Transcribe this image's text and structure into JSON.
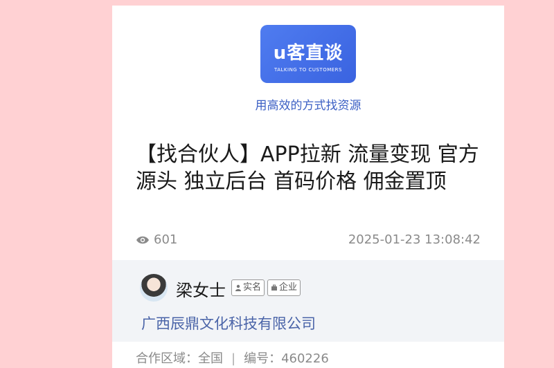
{
  "logo": {
    "text": "u客直谈",
    "subtitle": "TALKING TO CUSTOMERS",
    "color": "#4a74ee"
  },
  "tagline": "用高效的方式找资源",
  "post": {
    "title": "【找合伙人】APP拉新 流量变现 官方源头 独立后台 首码价格 佣金置顶",
    "views": "601",
    "date": "2025-01-23 13:08:42"
  },
  "author": {
    "name": "梁女士",
    "badges": [
      "实名",
      "企业"
    ],
    "company": "广西辰鼎文化科技有限公司"
  },
  "details": {
    "region_label": "合作区域：",
    "region_value": "全国",
    "separator": "|",
    "id_label": "编号：",
    "id_value": "460226"
  },
  "icons": {
    "views": "eye-icon",
    "badge_real": "person-icon",
    "badge_enterprise": "briefcase-icon"
  }
}
